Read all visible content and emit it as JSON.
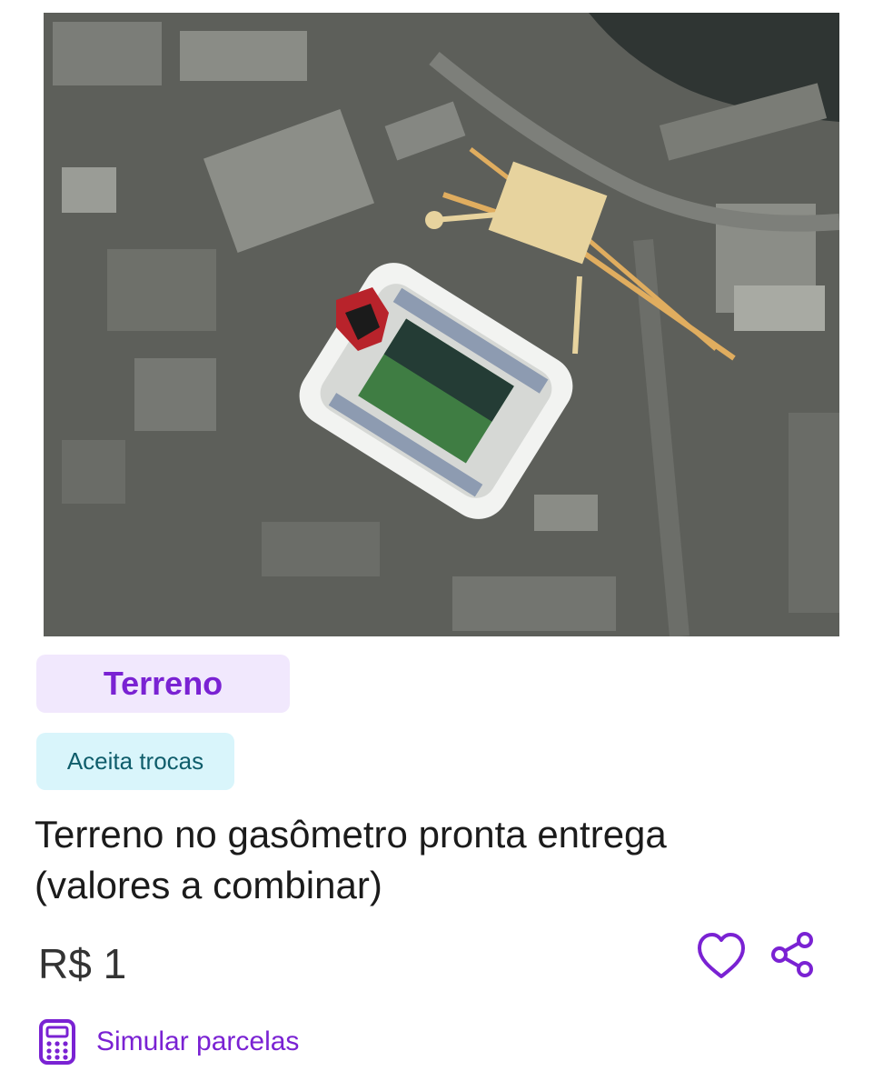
{
  "listing": {
    "image_alt": "Vista aérea de estádio no terreno do gasômetro",
    "category": "Terreno",
    "trade_badge": "Aceita trocas",
    "title_line1": "Terreno no gasômetro pronta entrega",
    "title_line2": "(valores a combinar)",
    "price": "R$ 1"
  },
  "actions": {
    "favorite_icon": "heart-outline-icon",
    "share_icon": "share-icon",
    "simulate_icon": "calculator-icon",
    "simulate_label": "Simular parcelas"
  },
  "colors": {
    "accent": "#7a22d3",
    "category_bg": "#f1e8fd",
    "trade_bg": "#d9f5fb",
    "trade_text": "#0f5d6b"
  }
}
